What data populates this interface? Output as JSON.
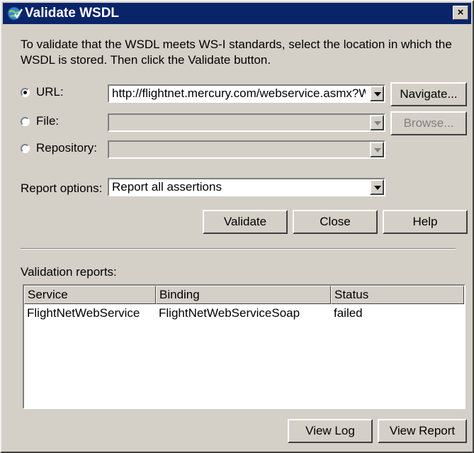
{
  "window": {
    "title": "Validate WSDL",
    "close_label": "×"
  },
  "intro_text": "To validate that the WSDL meets WS-I standards, select the location in which the WSDL is stored. Then click the Validate button.",
  "source": {
    "url": {
      "label": "URL:",
      "value": "http://flightnet.mercury.com/webservice.asmx?WSDL",
      "selected": true
    },
    "file": {
      "label": "File:",
      "value": "",
      "selected": false
    },
    "repository": {
      "label": "Repository:",
      "value": "",
      "selected": false
    }
  },
  "buttons": {
    "navigate": "Navigate...",
    "browse": "Browse...",
    "validate": "Validate",
    "close": "Close",
    "help": "Help",
    "view_log": "View Log",
    "view_report": "View Report"
  },
  "report_options": {
    "label": "Report options:",
    "value": "Report all assertions"
  },
  "reports": {
    "label": "Validation reports:",
    "columns": [
      "Service",
      "Binding",
      "Status"
    ],
    "rows": [
      {
        "service": "FlightNetWebService",
        "binding": "FlightNetWebServiceSoap",
        "status": "failed"
      }
    ]
  },
  "colors": {
    "titlebar": "#0a246a",
    "face": "#d4d0c8"
  },
  "icons": {
    "title": "globe-check-icon",
    "close": "close-icon"
  }
}
